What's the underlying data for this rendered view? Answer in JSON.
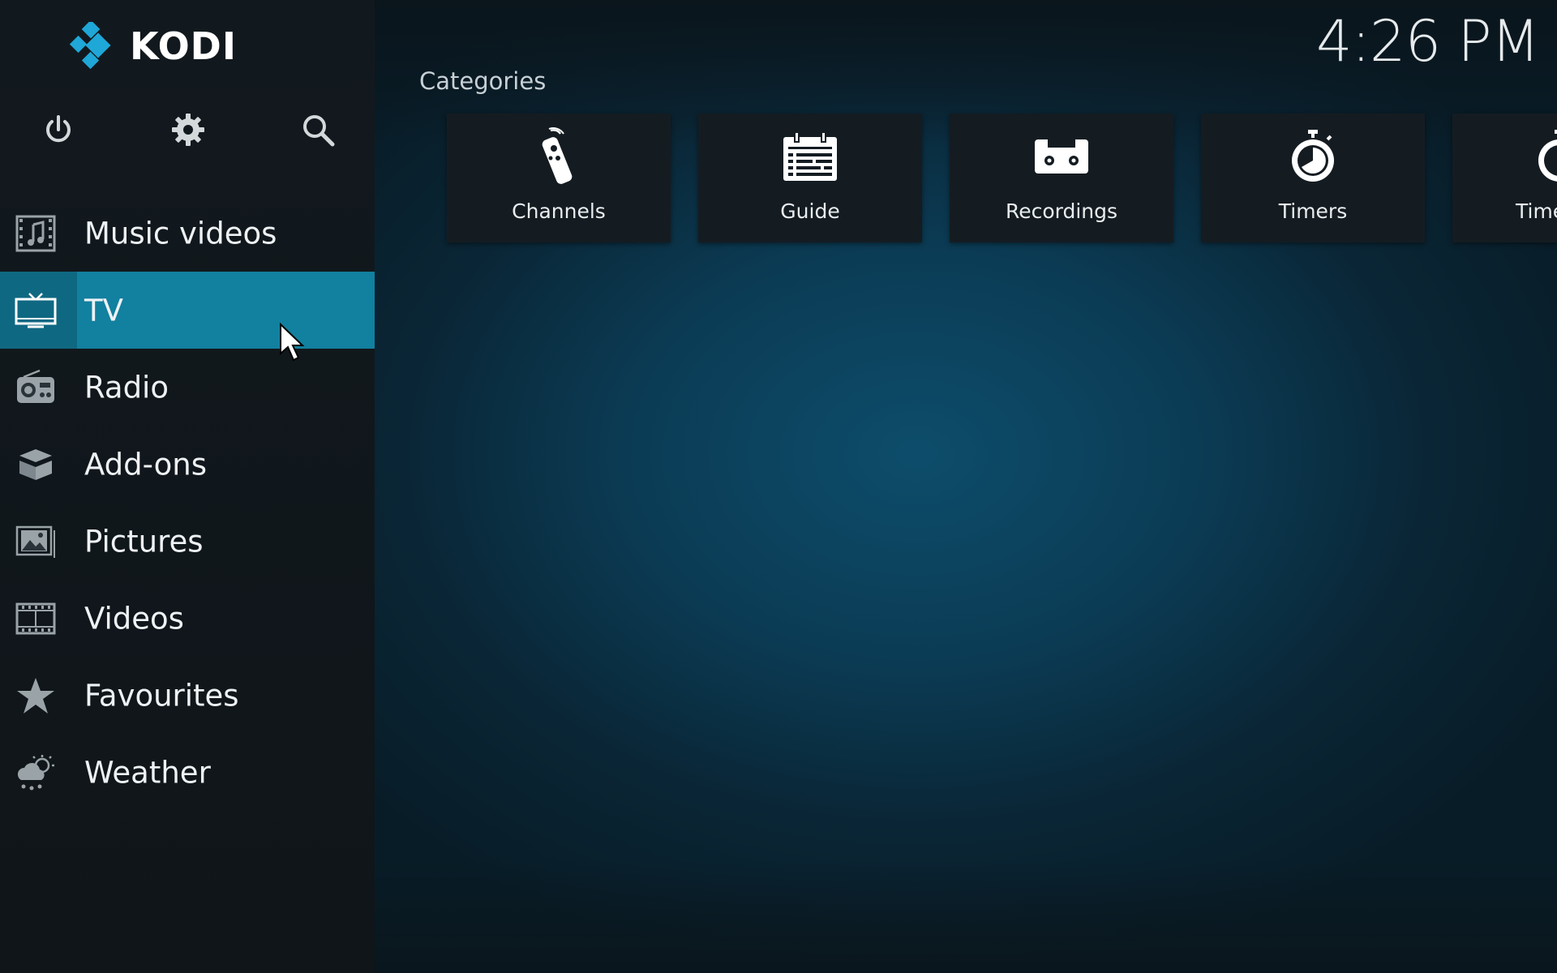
{
  "app": {
    "name": "KODI",
    "accent": "#12809f",
    "logo_color": "#1fa7d7"
  },
  "clock": "4:26 PM",
  "top_buttons": [
    {
      "name": "power",
      "icon": "power-icon"
    },
    {
      "name": "settings",
      "icon": "gear-icon"
    },
    {
      "name": "search",
      "icon": "search-icon"
    }
  ],
  "menu": [
    {
      "label": "Music videos",
      "icon": "music-video-icon"
    },
    {
      "label": "TV",
      "icon": "tv-icon",
      "active": true
    },
    {
      "label": "Radio",
      "icon": "radio-icon"
    },
    {
      "label": "Add-ons",
      "icon": "addons-box-icon"
    },
    {
      "label": "Pictures",
      "icon": "picture-icon"
    },
    {
      "label": "Videos",
      "icon": "film-icon"
    },
    {
      "label": "Favourites",
      "icon": "star-icon"
    },
    {
      "label": "Weather",
      "icon": "weather-icon"
    }
  ],
  "categories": {
    "heading": "Categories",
    "tiles": [
      {
        "label": "Channels",
        "icon": "remote-icon"
      },
      {
        "label": "Guide",
        "icon": "calendar-icon"
      },
      {
        "label": "Recordings",
        "icon": "cassette-icon"
      },
      {
        "label": "Timers",
        "icon": "stopwatch-icon"
      },
      {
        "label": "Time",
        "icon": "stopwatch-icon"
      }
    ]
  }
}
